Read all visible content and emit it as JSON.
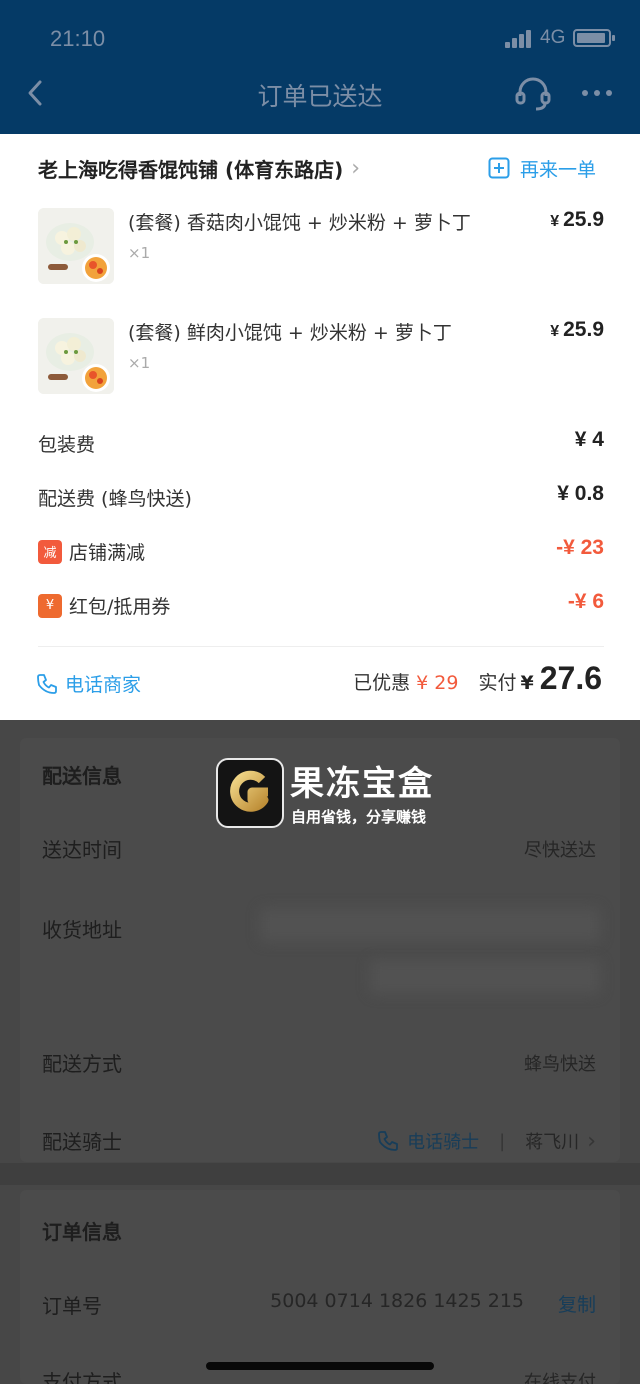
{
  "status_bar": {
    "time": "21:10",
    "network": "4G"
  },
  "nav": {
    "title": "订单已送达",
    "back_icon": "chevron-left-icon",
    "service_icon": "headset-icon",
    "more_icon": "more-dots-icon"
  },
  "shop": {
    "name": "老上海吃得香馄饨铺 (体育东路店)",
    "reorder_label": "再来一单"
  },
  "items": [
    {
      "name": "(套餐) 香菇肉小馄饨 + 炒米粉 + 萝卜丁",
      "qty": "×1",
      "currency": "¥",
      "price": "25.9"
    },
    {
      "name": "(套餐) 鲜肉小馄饨 + 炒米粉 + 萝卜丁",
      "qty": "×1",
      "currency": "¥",
      "price": "25.9"
    }
  ],
  "fees": [
    {
      "label": "包装费",
      "value": "¥ 4"
    },
    {
      "label": "配送费 (蜂鸟快送)",
      "value": "¥ 0.8"
    },
    {
      "badge": "减",
      "label": "店铺满减",
      "value": "-¥ 23"
    },
    {
      "badge": "¥",
      "label": "红包/抵用券",
      "value": "-¥ 6"
    }
  ],
  "summary": {
    "call_shop_label": "电话商家",
    "discount_label": "已优惠",
    "discount_value": "¥ 29",
    "paid_label": "实付",
    "paid_currency": "¥",
    "paid_value": "27.6"
  },
  "delivery": {
    "title": "配送信息",
    "time_label": "送达时间",
    "time_value": "尽快送达",
    "address_label": "收货地址",
    "method_label": "配送方式",
    "method_value": "蜂鸟快送",
    "rider_label": "配送骑士",
    "call_rider_label": "电话骑士",
    "rider_name": "蒋飞川"
  },
  "order": {
    "title": "订单信息",
    "number_label": "订单号",
    "number_value": "5004 0714 1826 1425 215",
    "copy_label": "复制",
    "payment_label": "支付方式",
    "payment_value": "在线支付"
  },
  "watermark": {
    "name": "果冻宝盒",
    "slogan": "自用省钱，分享赚钱"
  },
  "colors": {
    "header": "#053a66",
    "accent_blue": "#2b9ee8",
    "discount_red": "#f25a3c",
    "overlay": "#474747"
  }
}
